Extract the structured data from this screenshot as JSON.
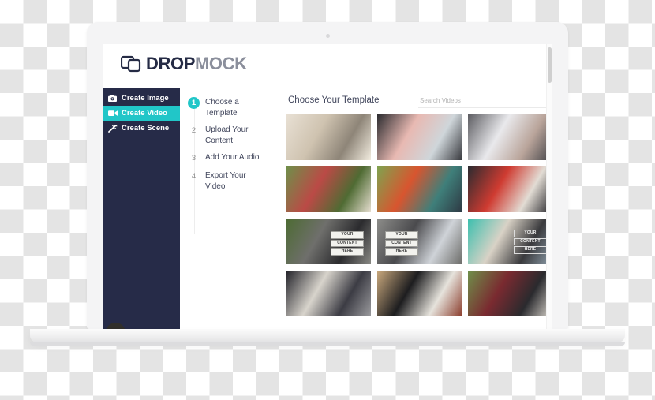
{
  "app": {
    "logo": {
      "icon": "overlapping-screens-logo-icon",
      "text_primary": "DROP",
      "text_secondary": "MOCK"
    },
    "accent_color": "#21c6c8",
    "sidebar_color": "#262b48"
  },
  "sidebar": {
    "items": [
      {
        "label": "Create Image",
        "icon": "camera-icon",
        "active": false
      },
      {
        "label": "Create Video",
        "icon": "video-camera-icon",
        "active": true
      },
      {
        "label": "Create Scene",
        "icon": "magic-wand-icon",
        "active": false
      }
    ],
    "avatar_icon": "user-avatar-icon",
    "footer_text": "",
    "footer_badge_icon": "status-badge-icon"
  },
  "steps": {
    "items": [
      {
        "number": "1",
        "label": "Choose a Template",
        "current": true
      },
      {
        "number": "2",
        "label": "Upload Your Content",
        "current": false
      },
      {
        "number": "3",
        "label": "Add Your Audio",
        "current": false
      },
      {
        "number": "4",
        "label": "Export Your Video",
        "current": false
      }
    ]
  },
  "main": {
    "title": "Choose Your Template",
    "search": {
      "placeholder": "Search Videos",
      "value": ""
    },
    "thumbnails": [
      {
        "name": "woman-at-mall-balcony-railing",
        "overlay": null,
        "c1": "#e8e0d4",
        "c2": "#cfc3b0",
        "c3": "#8e8578",
        "c4": "#f2ecdf"
      },
      {
        "name": "blonde-woman-in-pink-at-kitchen-counter",
        "overlay": null,
        "c1": "#2c2c30",
        "c2": "#e8b9b2",
        "c3": "#cfd6da",
        "c4": "#3a3b40"
      },
      {
        "name": "woman-working-at-imac-desktop",
        "overlay": null,
        "c1": "#5d5d62",
        "c2": "#e9e9ec",
        "c3": "#b9a49a",
        "c4": "#3f4045"
      },
      {
        "name": "friends-picnic-on-grass-blanket",
        "overlay": null,
        "c1": "#6f8f4a",
        "c2": "#bb4a46",
        "c3": "#4f6b33",
        "c4": "#e6ded0"
      },
      {
        "name": "man-pitching-tent-camping",
        "overlay": null,
        "c1": "#7fa34f",
        "c2": "#d8552f",
        "c3": "#3f7f7a",
        "c4": "#2e3a44"
      },
      {
        "name": "woman-relaxing-on-red-lounge-chair",
        "overlay": null,
        "c1": "#2b2b30",
        "c2": "#cf3b31",
        "c3": "#e2dcd4",
        "c4": "#1f1f24"
      },
      {
        "name": "woman-walking-by-hedge-with-content-placeholder",
        "overlay": "YOUR|CONTENT|HERE",
        "c1": "#4d6b33",
        "c2": "#6f6f6c",
        "c3": "#2b2b2e",
        "c4": "#8a8a85"
      },
      {
        "name": "man-with-tablet-in-store-with-content-placeholder",
        "overlay": "YOUR|CONTENT|HERE",
        "c1": "#8d8d8a",
        "c2": "#4a4a4d",
        "c3": "#cfd3d8",
        "c4": "#6d6d6a"
      },
      {
        "name": "woman-sitting-by-graffiti-wall-with-content-placeholder",
        "overlay": "YOUR|CONTENT|HERE",
        "c1": "#3bbfae",
        "c2": "#d9d2c6",
        "c3": "#3a3a3d",
        "c4": "#8fa0ad"
      },
      {
        "name": "business-meeting-at-window",
        "overlay": null,
        "c1": "#23232a",
        "c2": "#d8d4cc",
        "c3": "#3c3c44",
        "c4": "#9b9b9e"
      },
      {
        "name": "tablet-displaying-newspaper-on-books",
        "overlay": null,
        "c1": "#caa97d",
        "c2": "#1d1d1f",
        "c3": "#e6e3dc",
        "c4": "#8c3f2f"
      },
      {
        "name": "two-people-at-outdoor-cafe-counter",
        "overlay": null,
        "c1": "#6f8f4a",
        "c2": "#7a2a30",
        "c3": "#2a2a2e",
        "c4": "#ddd8cf"
      }
    ]
  },
  "scrollbar": {
    "name": "vertical-scrollbar",
    "thumb_position_percent": 1
  }
}
